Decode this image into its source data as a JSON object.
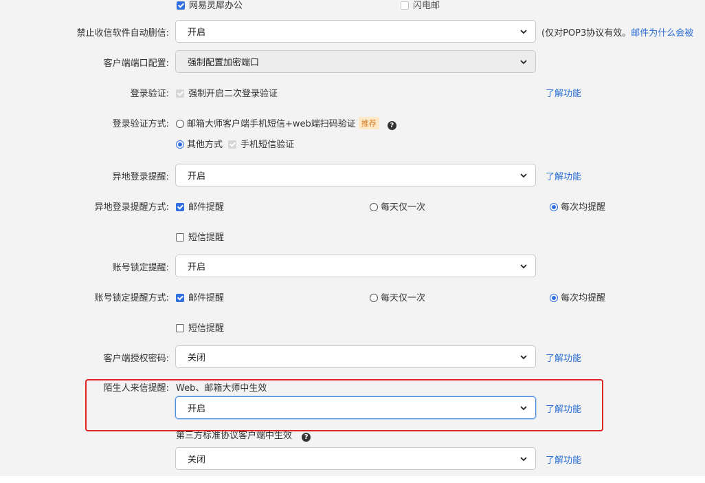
{
  "top_row": {
    "option1": "网易灵犀办公",
    "option2": "闪电邮"
  },
  "auto_delete": {
    "label": "禁止收信软件自动删信:",
    "value": "开启",
    "note": "(仅对POP3协议有效。",
    "note_link": "邮件为什么会被"
  },
  "client_port": {
    "label": "客户端端口配置:",
    "value": "强制配置加密端口"
  },
  "login_verify": {
    "label": "登录验证:",
    "checkbox_label": "强制开启二次登录验证",
    "link": "了解功能"
  },
  "verify_method": {
    "label": "登录验证方式:",
    "option1": "邮箱大师客户端手机短信+web端扫码验证",
    "badge": "推荐",
    "option2": "其他方式",
    "option2_sub": "手机短信验证"
  },
  "remote_login": {
    "label": "异地登录提醒:",
    "value": "开启",
    "link": "了解功能"
  },
  "remote_login_method": {
    "label": "异地登录提醒方式:",
    "mail": "邮件提醒",
    "once_daily": "每天仅一次",
    "every_time": "每次均提醒",
    "sms": "短信提醒"
  },
  "account_lock": {
    "label": "账号锁定提醒:",
    "value": "开启"
  },
  "account_lock_method": {
    "label": "账号锁定提醒方式:",
    "mail": "邮件提醒",
    "once_daily": "每天仅一次",
    "every_time": "每次均提醒",
    "sms": "短信提醒"
  },
  "client_auth": {
    "label": "客户端授权密码:",
    "value": "关闭",
    "link": "了解功能"
  },
  "stranger_mail": {
    "label": "陌生人来信提醒:",
    "scope_web": "Web、邮箱大师中生效",
    "web_value": "开启",
    "web_link": "了解功能",
    "scope_third": "第三方标准协议客户端中生效",
    "third_value": "关闭",
    "third_link": "了解功能"
  },
  "colors": {
    "accent": "#2f6fe0",
    "link": "#2a6fd6",
    "highlight": "#e02424"
  }
}
